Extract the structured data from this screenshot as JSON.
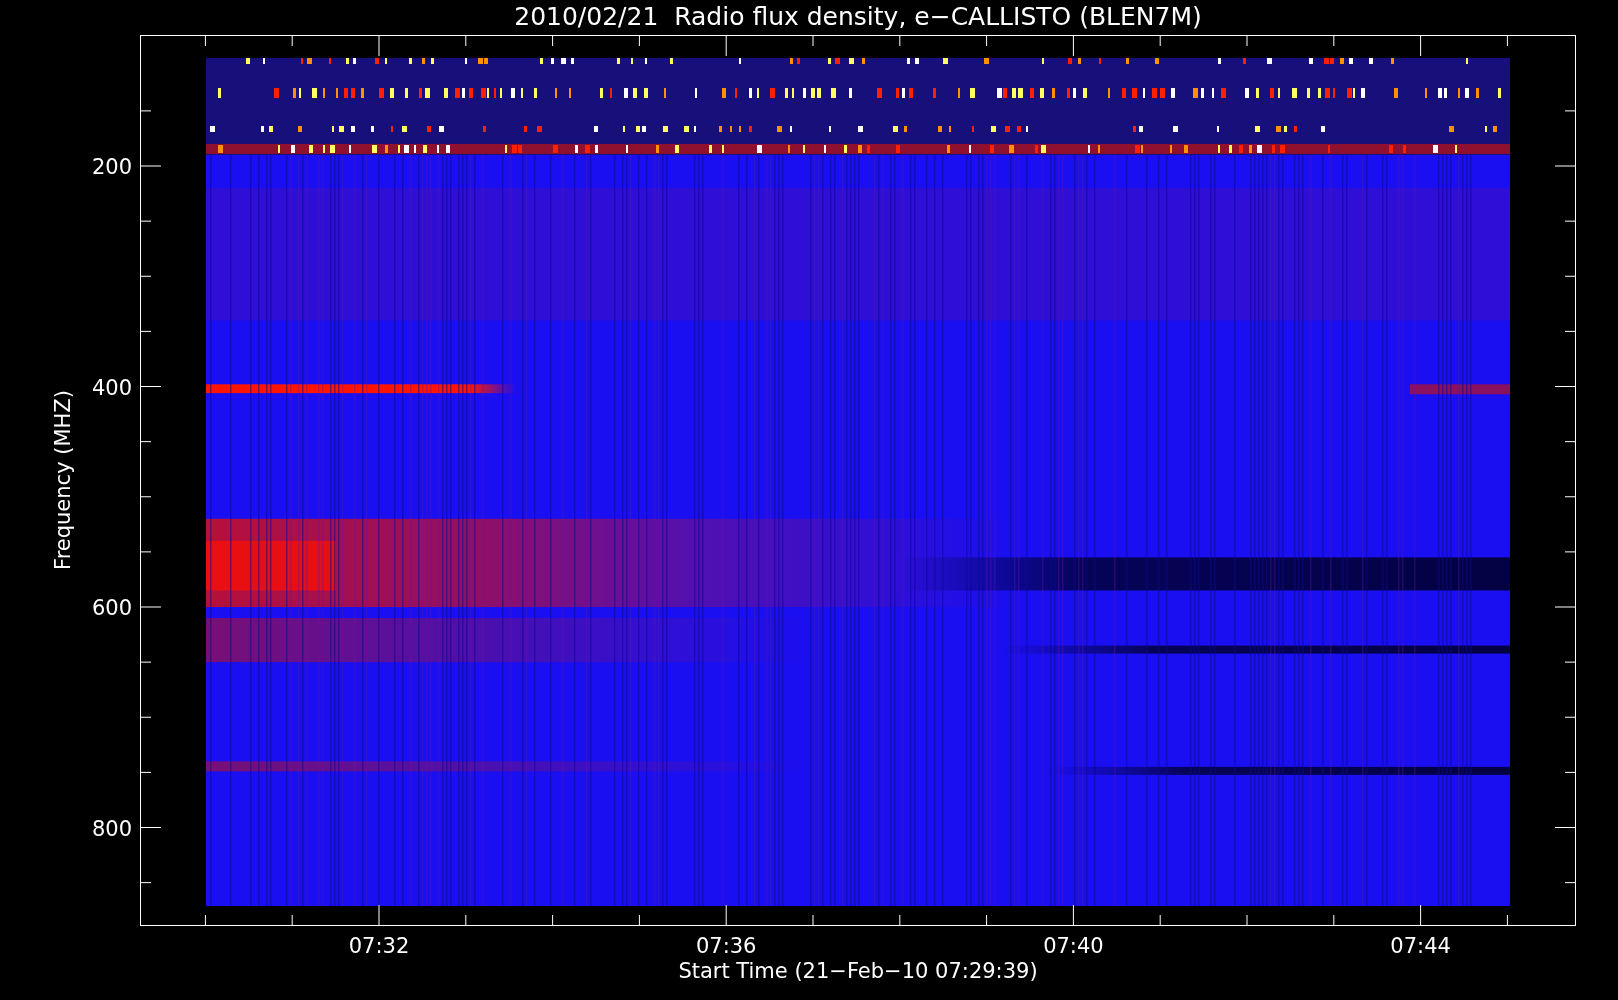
{
  "title": "2010/02/21  Radio flux density, e−CALLISTO (BLEN7M)",
  "y_axis": {
    "label": "Frequency (MHZ)",
    "ticks": [
      "200",
      "400",
      "600",
      "800"
    ]
  },
  "x_axis": {
    "label": "Start Time (21−Feb−10 07:29:39)",
    "ticks": [
      "07:32",
      "07:36",
      "07:40",
      "07:44"
    ]
  }
}
